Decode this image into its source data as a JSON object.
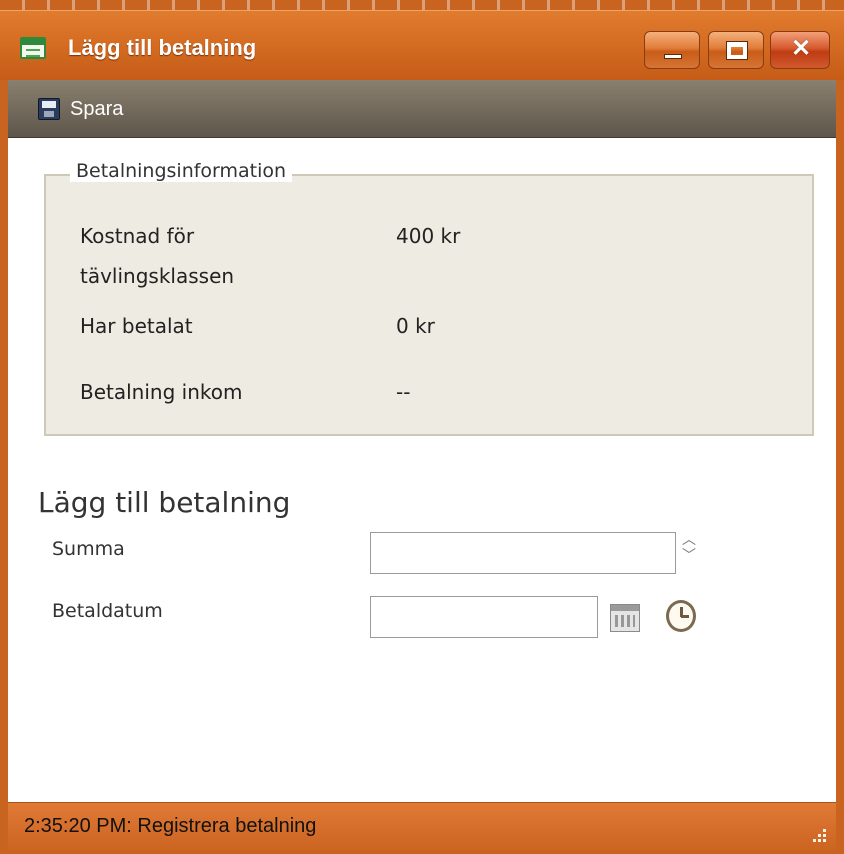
{
  "window": {
    "title": "Lägg till betalning"
  },
  "toolbar": {
    "save_label": "Spara"
  },
  "payment_info": {
    "legend": "Betalningsinformation",
    "rows": [
      {
        "label_line1": "Kostnad för",
        "label_line2": "tävlingsklassen",
        "value": "400 kr"
      },
      {
        "label": "Har betalat",
        "value": "0 kr"
      },
      {
        "label": "Betalning inkom",
        "value": "--"
      }
    ]
  },
  "add_payment": {
    "title": "Lägg till betalning",
    "amount_label": "Summa",
    "amount_value": "",
    "date_label": "Betaldatum",
    "date_value": ""
  },
  "status": {
    "text": "2:35:20 PM: Registrera betalning"
  },
  "icons": {
    "window": "window-icon",
    "save": "save-icon",
    "calendar": "calendar-icon",
    "clock": "clock-icon"
  },
  "colors": {
    "titlebar": "#d06a25",
    "toolbar": "#6f665a",
    "groupbox": "#eeebe2",
    "statusbar": "#d9732f"
  }
}
